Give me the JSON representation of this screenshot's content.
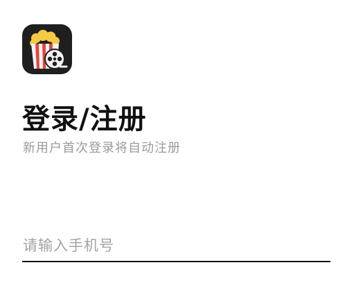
{
  "logo": {
    "icon": "popcorn-film-reel-icon",
    "colors": {
      "background": "#1f1f1f",
      "popcorn": "#f6c944",
      "stripe_red": "#e8443a",
      "reel": "#f2f2f2"
    }
  },
  "header": {
    "title": "登录/注册",
    "subtitle": "新用户首次登录将自动注册"
  },
  "form": {
    "phone": {
      "value": "",
      "placeholder": "请输入手机号"
    }
  },
  "colors": {
    "title": "#111111",
    "subtitle": "#9a9a9a",
    "placeholder": "#a3a3a3",
    "underline": "#111111"
  }
}
